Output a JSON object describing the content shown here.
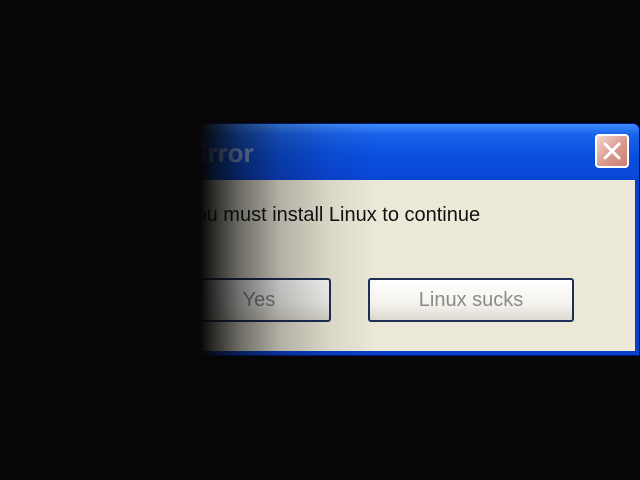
{
  "dialog": {
    "title": "Error",
    "message": "You must install Linux to continue",
    "buttons": {
      "yes_label": "Yes",
      "sucks_label": "Linux sucks"
    },
    "close_icon": "close-icon"
  },
  "colors": {
    "titlebar": "#0a4fe0",
    "dialog_body": "#ece9d8",
    "background": "#060606",
    "close_button": "#d9998d"
  }
}
